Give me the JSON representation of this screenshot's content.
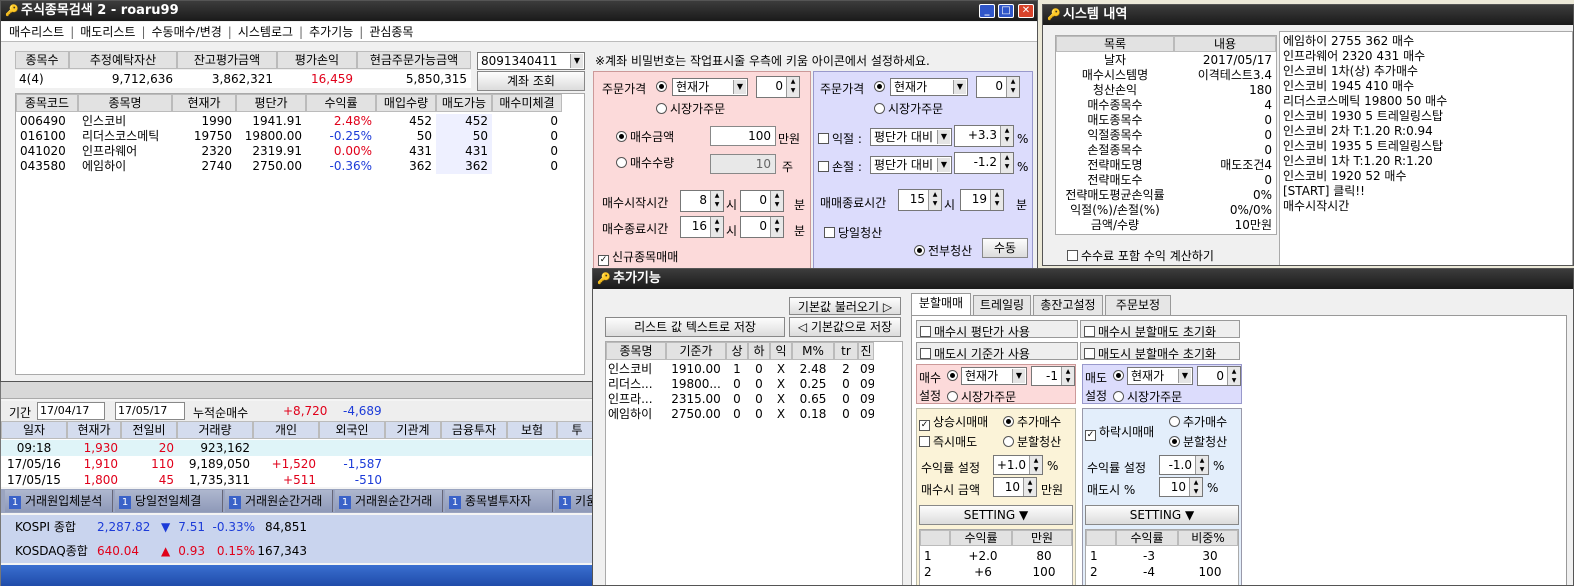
{
  "main": {
    "title": "주식종목검색 2 - roaru99",
    "menu": [
      "매수리스트",
      "매도리스트",
      "수동매수/변경",
      "시스템로그",
      "추가기능",
      "관심종목"
    ],
    "summary_headers": [
      "종목수",
      "추정예탁자산",
      "잔고평가금액",
      "평가손익",
      "현금주문가능금액"
    ],
    "summary_values": [
      "4(4)",
      "9,712,636",
      "3,862,321",
      "16,459",
      "5,850,315"
    ],
    "account": "8091340411",
    "account_btn": "계좌 조회",
    "notice": "※계좌 비밀번호는 작업표시줄 우측에 키움 아이콘에서 설정하세요.",
    "stock_headers": [
      "종목코드",
      "종목명",
      "현재가",
      "평단가",
      "수익률",
      "매입수량",
      "매도가능",
      "매수미체결"
    ],
    "stocks": [
      [
        "006490",
        "인스코비",
        "1990",
        "1941.91",
        "2.48%",
        "452",
        "452",
        "0"
      ],
      [
        "016100",
        "리더스코스메틱",
        "19750",
        "19800.00",
        "-0.25%",
        "50",
        "50",
        "0"
      ],
      [
        "041020",
        "인프라웨어",
        "2320",
        "2319.91",
        "0.00%",
        "431",
        "431",
        "0"
      ],
      [
        "043580",
        "에임하이",
        "2740",
        "2750.00",
        "-0.36%",
        "362",
        "362",
        "0"
      ]
    ],
    "buy": {
      "order_price": "주문가격",
      "price_type": "현재가",
      "offset": "0",
      "market": "시장가주문",
      "amount_label": "매수금액",
      "amount": "100",
      "amount_unit": "만원",
      "qty_label": "매수수량",
      "qty": "10",
      "qty_unit": "주",
      "start_label": "매수시작시간",
      "start_h": "8",
      "start_m": "0",
      "end_label": "매수종료시간",
      "end_h": "16",
      "end_m": "0",
      "hour": "시",
      "min": "분",
      "new_label": "신규종목매매"
    },
    "sell": {
      "order_price": "주문가격",
      "price_type": "현재가",
      "offset": "0",
      "market": "시장가주문",
      "profit_label": "익절 :",
      "profit_basis": "평단가 대비",
      "profit": "+3.3",
      "loss_label": "손절 :",
      "loss_basis": "평단가 대비",
      "loss": "-1.2",
      "pct": "%",
      "end_label": "매매종료시간",
      "end_h": "15",
      "end_m": "19",
      "hour": "시",
      "min": "분",
      "same_day": "당일청산",
      "all": "전부청산",
      "manual": "수동"
    }
  },
  "history": {
    "title": "시스템 내역",
    "header": [
      "목록",
      "내용"
    ],
    "rows": [
      [
        "날자",
        "2017/05/17"
      ],
      [
        "매수시스템명",
        "이격테스트3.4"
      ],
      [
        "청산손익",
        "180"
      ],
      [
        "매수종목수",
        "4"
      ],
      [
        "매도종목수",
        "0"
      ],
      [
        "익절종목수",
        "0"
      ],
      [
        "손절종목수",
        "0"
      ],
      [
        "전략매도명",
        "매도조건4"
      ],
      [
        "전략매도수",
        "0"
      ],
      [
        "전략매도평균손익률",
        "0%"
      ],
      [
        "익절(%)/손절(%)",
        "0%/0%"
      ],
      [
        "금액/수량",
        "10만원"
      ]
    ],
    "log": [
      "에임하이 2755 362 매수",
      "인프라웨어 2320 431 매수",
      "인스코비 1차(상) 추가매수",
      "인스코비 1945 410 매수",
      "리더스코스메틱 19800 50 매수",
      "인스코비 1930 5 트레일링스탑",
      "인스코비 2차 T:1.20 R:0.94",
      "인스코비 1935 5 트레일링스탑",
      "인스코비 1차 T:1.20 R:1.20",
      "인스코비 1920 52 매수",
      "[START] 클릭!!",
      "매수시작시간"
    ],
    "fee_label": "수수료 포함 수익 계산하기"
  },
  "back": {
    "period": "기간",
    "date1": "17/04/17",
    "date2": "17/05/17",
    "net_label": "누적순매수",
    "net1": "+8,720",
    "net2": "-4,689",
    "headers": [
      "일자",
      "현재가",
      "전일비",
      "거래량",
      "개인",
      "외국인",
      "기관계",
      "금융투자",
      "보험",
      "투"
    ],
    "rows": [
      [
        "09:18",
        "1,930",
        "20",
        "923,162",
        "",
        "",
        "",
        "",
        "",
        ""
      ],
      [
        "17/05/16",
        "1,910",
        "110",
        "9,189,050",
        "+1,520",
        "-1,587",
        "",
        "",
        "",
        ""
      ],
      [
        "17/05/15",
        "1,800",
        "45",
        "1,735,311",
        "+511",
        "-510",
        "",
        "",
        "",
        ""
      ]
    ],
    "tiles": [
      "거래원입체분석",
      "당일전일체결",
      "거래원순간거래",
      "거래원순간거래",
      "종목별투자자",
      "키움"
    ],
    "index": [
      {
        "name": "KOSPI 종합",
        "value": "2,287.82",
        "change": "7.51",
        "pct": "-0.33%",
        "vol": "84,851",
        "dir": "▼"
      },
      {
        "name": "KOSDAQ종합",
        "value": "640.04",
        "change": "0.93",
        "pct": "0.15%",
        "vol": "167,343",
        "dir": "▲"
      }
    ]
  },
  "extra": {
    "title": "추가기능",
    "load_btn": "기본값 불러오기 ▷",
    "save_text_btn": "리스트 값 텍스트로 저장",
    "save_default_btn": "◁ 기본값으로 저장",
    "list_headers": [
      "종목명",
      "기준가",
      "상",
      "하",
      "익",
      "M%",
      "tr",
      "진"
    ],
    "list": [
      [
        "인스코비",
        "1910.00",
        "1",
        "0",
        "X",
        "2.48",
        "2",
        "09"
      ],
      [
        "리더스...",
        "19800...",
        "0",
        "0",
        "X",
        "0.25",
        "0",
        "09"
      ],
      [
        "인프라...",
        "2315.00",
        "0",
        "0",
        "X",
        "0.65",
        "0",
        "09"
      ],
      [
        "에임하이",
        "2750.00",
        "0",
        "0",
        "X",
        "0.18",
        "0",
        "09"
      ]
    ],
    "tabs": [
      "분할매매",
      "트레일링",
      "총잔고설정",
      "주문보정"
    ],
    "opt1": "매수시 평단가 사용",
    "opt2": "매수시 분할매도 초기화",
    "opt3": "매도시 기준가 사용",
    "opt4": "매도시 분할매수 초기화",
    "buy_set": "매수",
    "buy_set2": "설정",
    "sell_set": "매도",
    "sell_set2": "설정",
    "price_type": "현재가",
    "market": "시장가주문",
    "buy_offset": "-1",
    "sell_offset": "0",
    "rise": "상승시매매",
    "add_buy": "추가매수",
    "instant_sell": "즉시매도",
    "split_clear": "분할청산",
    "fall": "하락시매매",
    "fall_add": "추가매수",
    "fall_split": "분할청산",
    "profit_set": "수익률 설정",
    "rise_profit": "+1.0",
    "pct": "%",
    "buy_amt_label": "매수시 금액",
    "rise_amt": "10",
    "won": "만원",
    "fall_profit": "-1.0",
    "sell_pct_label": "매도시 %",
    "fall_pct": "10",
    "setting": "SETTING ▼",
    "left_table_headers": [
      "수익률",
      "만원"
    ],
    "left_table": [
      [
        "1",
        "+2.0",
        "80"
      ],
      [
        "2",
        "+6",
        "100"
      ]
    ],
    "right_table_headers": [
      "수익률",
      "비중%"
    ],
    "right_table": [
      [
        "1",
        "-3",
        "30"
      ],
      [
        "2",
        "-4",
        "100"
      ]
    ]
  }
}
